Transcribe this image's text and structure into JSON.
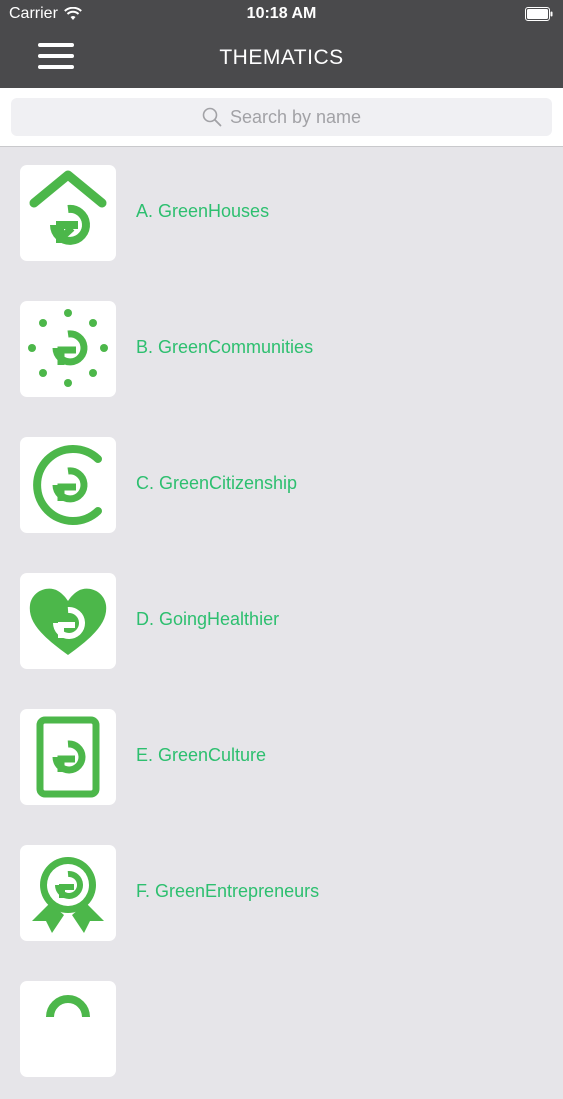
{
  "status_bar": {
    "carrier": "Carrier",
    "time": "10:18 AM"
  },
  "nav": {
    "title": "THEMATICS",
    "menu_icon": "hamburger-menu-icon"
  },
  "search": {
    "placeholder": "Search by name",
    "icon": "search-icon"
  },
  "colors": {
    "header_bg": "#4a4a4c",
    "accent_green": "#4cb74a",
    "label_green": "#2dbf6f",
    "list_bg": "#e6e5e9"
  },
  "thematics": [
    {
      "label": "A. GreenHouses",
      "icon": "house-recycle-icon"
    },
    {
      "label": "B. GreenCommunities",
      "icon": "dots-circle-recycle-icon"
    },
    {
      "label": "C. GreenCitizenship",
      "icon": "c-recycle-icon"
    },
    {
      "label": "D. GoingHealthier",
      "icon": "heart-recycle-icon"
    },
    {
      "label": "E. GreenCulture",
      "icon": "card-recycle-icon"
    },
    {
      "label": "F. GreenEntrepreneurs",
      "icon": "badge-recycle-icon"
    },
    {
      "label": "",
      "icon": "recycle-icon"
    }
  ]
}
